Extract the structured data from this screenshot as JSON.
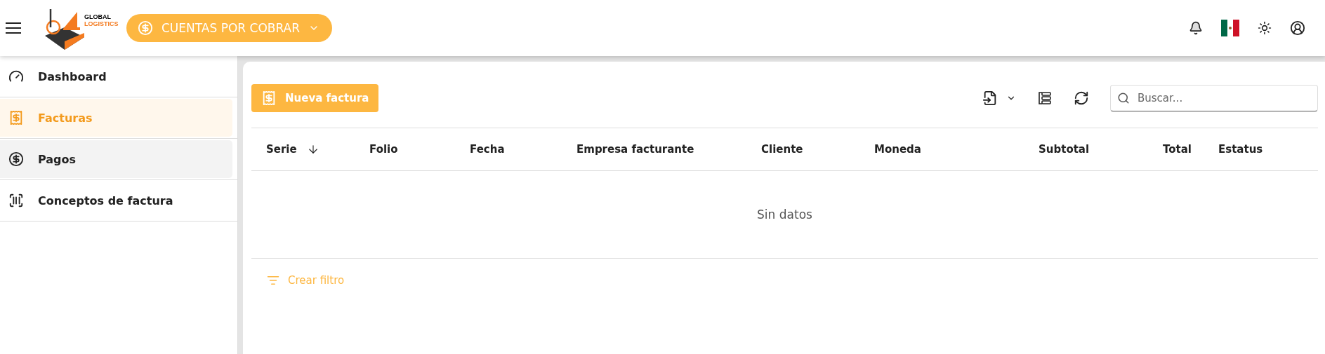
{
  "header": {
    "logo": {
      "line_1": "GLOBAL",
      "line_2": "LOGISTICS"
    },
    "module_button": {
      "label": "CUENTAS POR COBRAR"
    }
  },
  "sidebar": {
    "items": [
      {
        "label": "Dashboard",
        "selected": false,
        "hovered": false
      },
      {
        "label": "Facturas",
        "selected": true,
        "hovered": false
      },
      {
        "label": "Pagos",
        "selected": false,
        "hovered": true
      },
      {
        "label": "Conceptos de factura",
        "selected": false,
        "hovered": false
      }
    ]
  },
  "toolbar": {
    "new_button": {
      "label": "Nueva factura"
    },
    "search": {
      "placeholder": "Buscar..."
    }
  },
  "table": {
    "columns": [
      {
        "label": "Serie",
        "sorted": true
      },
      {
        "label": "Folio",
        "sorted": false
      },
      {
        "label": "Fecha",
        "sorted": false
      },
      {
        "label": "Empresa facturante",
        "sorted": false
      },
      {
        "label": "Cliente",
        "sorted": false
      },
      {
        "label": "Moneda",
        "sorted": false
      },
      {
        "label": "Subtotal",
        "sorted": false
      },
      {
        "label": "Total",
        "sorted": false
      },
      {
        "label": "Estatus",
        "sorted": false
      }
    ],
    "empty_text": "Sin datos"
  },
  "filter_link": {
    "label": "Crear filtro"
  }
}
